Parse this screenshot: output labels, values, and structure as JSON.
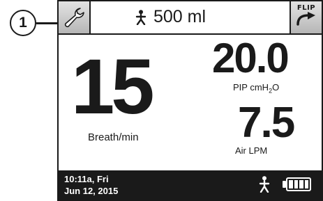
{
  "callout": {
    "number": "1"
  },
  "topbar": {
    "settings_icon": "wrench-icon",
    "patient_icon": "person-icon",
    "volume": "500 ml",
    "flip_label": "FLIP"
  },
  "readings": {
    "breath_rate": {
      "value": "15",
      "label": "Breath/min"
    },
    "pip": {
      "value": "20.0",
      "label_prefix": "PIP  cmH",
      "label_sub": "2",
      "label_suffix": "O"
    },
    "air_flow": {
      "value": "7.5",
      "label": "Air  LPM"
    }
  },
  "statusbar": {
    "time": "10:11a, Fri",
    "date": "Jun 12, 2015",
    "battery_level": 1.0
  }
}
